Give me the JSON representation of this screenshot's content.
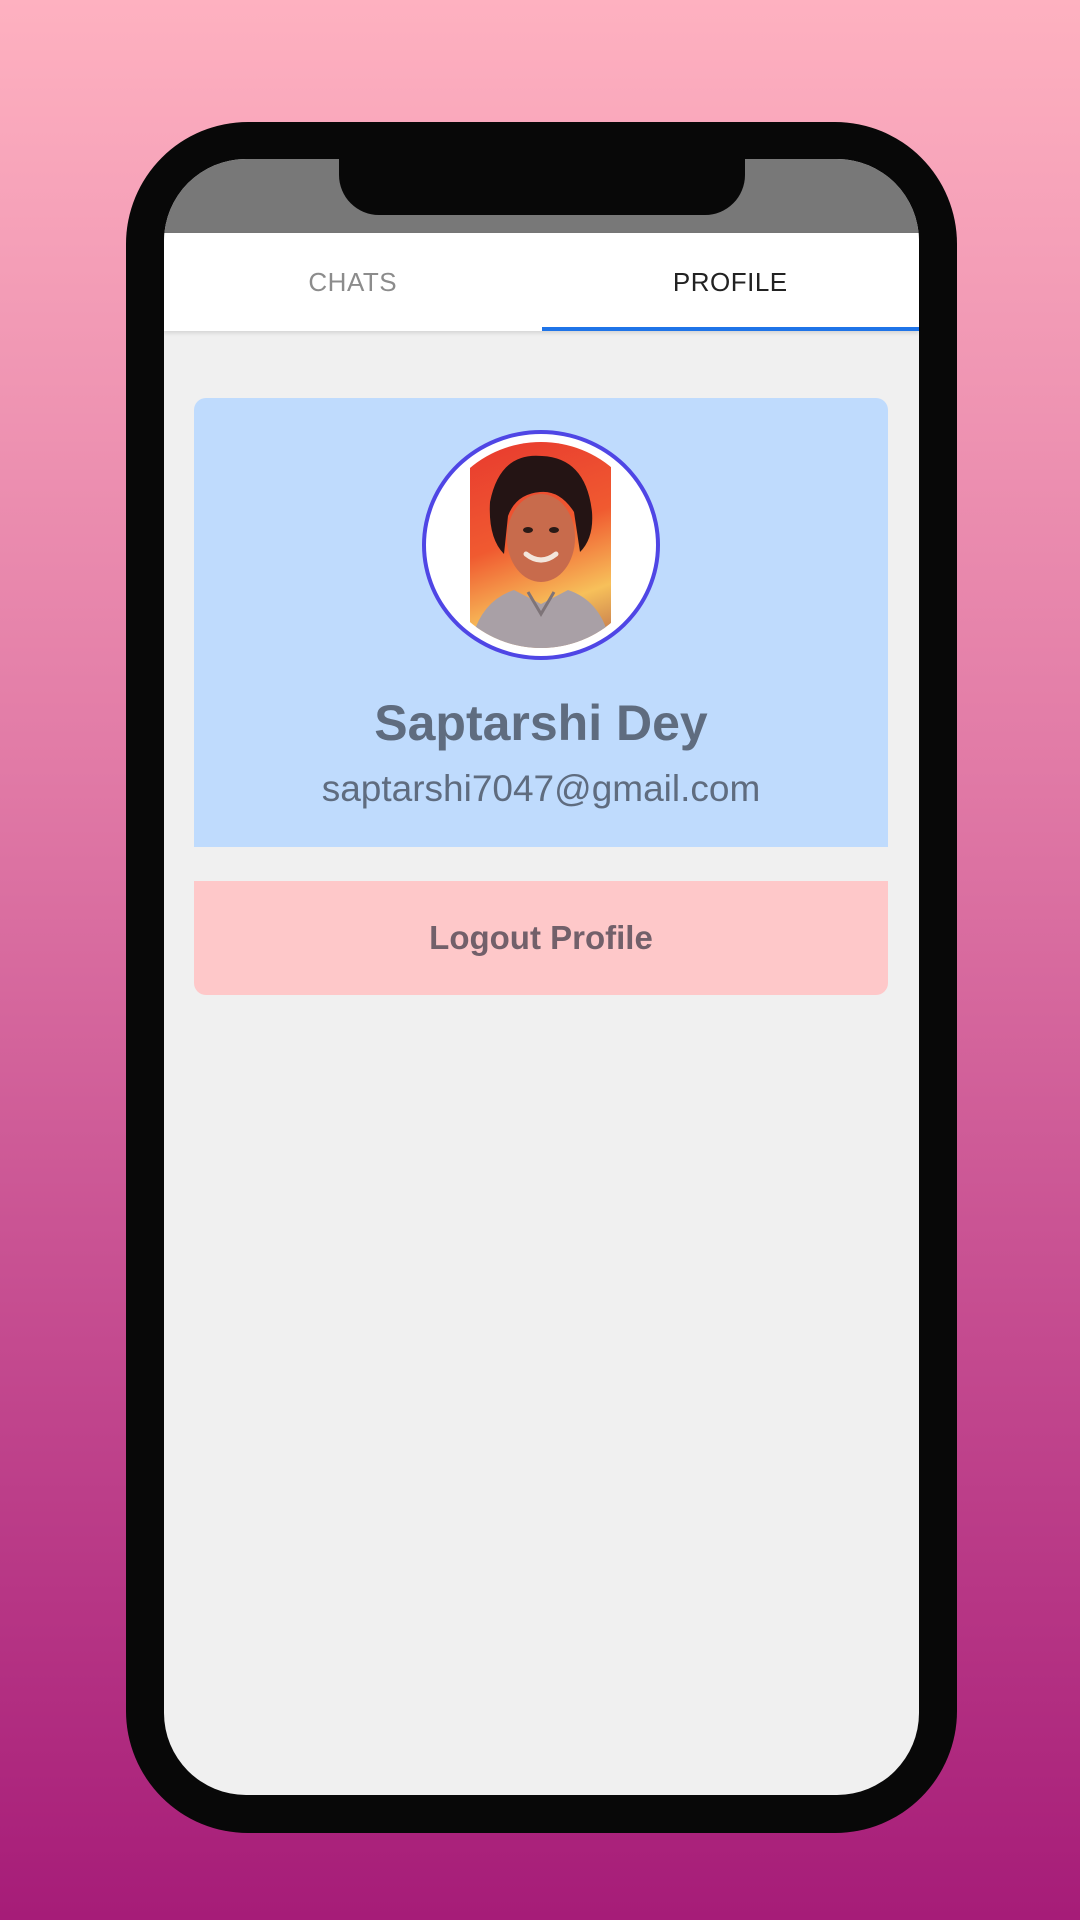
{
  "tabs": {
    "chats_label": "CHATS",
    "profile_label": "PROFILE",
    "active": "PROFILE"
  },
  "profile": {
    "name": "Saptarshi Dey",
    "email": "saptarshi7047@gmail.com"
  },
  "actions": {
    "logout_label": "Logout Profile"
  },
  "colors": {
    "accent": "#1f74e8",
    "card": "#bfdbfd",
    "logout": "#fec8c9",
    "avatar_ring": "#4f46e5"
  }
}
